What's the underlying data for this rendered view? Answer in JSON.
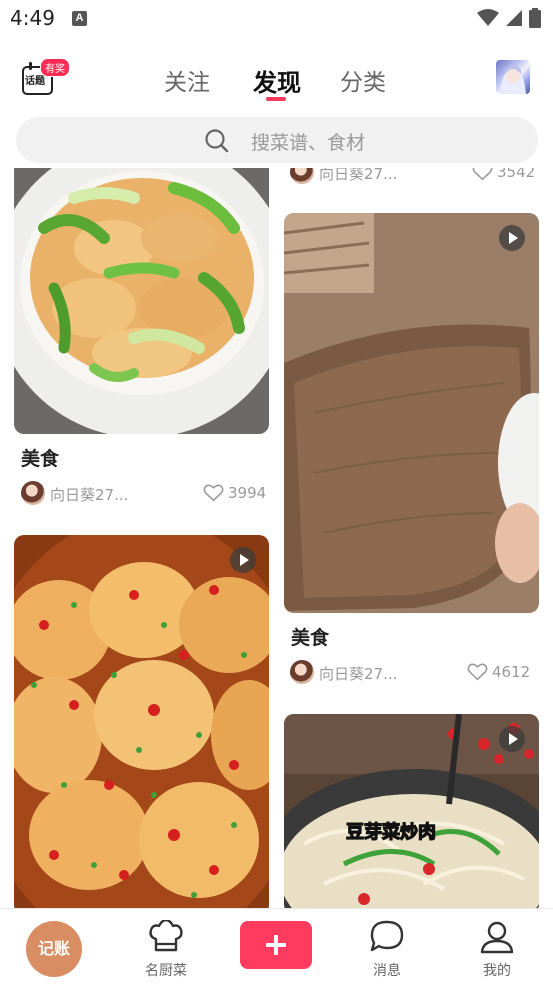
{
  "status_bar": {
    "time": "4:49",
    "notification_glyph": "A"
  },
  "header": {
    "topic": {
      "label": "话题",
      "badge": "有奖"
    },
    "tabs": [
      {
        "label": "关注",
        "active": false
      },
      {
        "label": "发现",
        "active": true
      },
      {
        "label": "分类",
        "active": false
      }
    ],
    "accent_color": "#ff3a5e"
  },
  "search": {
    "placeholder": "搜菜谱、食材"
  },
  "feed": {
    "left_column": [
      {
        "title": "美食",
        "author": "向日葵27...",
        "likes": "3994",
        "has_video": false
      },
      {
        "title": "",
        "author": "",
        "likes": "",
        "has_video": true
      }
    ],
    "right_column": [
      {
        "title": "",
        "author": "向日葵27...",
        "likes": "3542",
        "has_video": false
      },
      {
        "title": "美食",
        "author": "向日葵27...",
        "likes": "4612",
        "has_video": true
      },
      {
        "title": "",
        "author": "",
        "likes": "",
        "has_video": true,
        "overlay_text": "豆芽菜炒肉"
      }
    ]
  },
  "bottom_nav": {
    "bookkeep": "记账",
    "items": [
      {
        "label": "名厨菜",
        "icon": "chef-hat-icon"
      },
      {
        "label": "",
        "icon": "plus-icon"
      },
      {
        "label": "消息",
        "icon": "message-bubble-icon"
      },
      {
        "label": "我的",
        "icon": "user-icon"
      }
    ],
    "add_color": "#ff3b5f"
  }
}
